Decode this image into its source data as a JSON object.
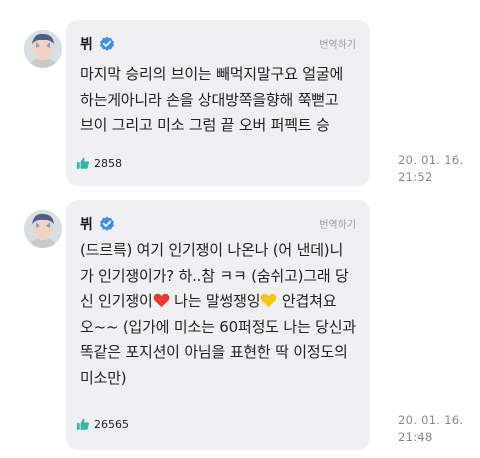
{
  "posts": [
    {
      "author": "뷔",
      "translate_label": "번역하기",
      "text": "마지막 승리의 브이는 빼먹지말구요 얼굴에\n하는게아니라 손을 상대방쪽을향해 쭉뻗고\n브이 그리고 미소 그럼 끝 오버 퍼펙트 승",
      "likes": "2858",
      "date": "20. 01. 16.",
      "time": "21:52"
    },
    {
      "author": "뷔",
      "translate_label": "번역하기",
      "text_before_heart": "(드르륵) 여기 인기쟁이 나온나 (어 낸데)니\n가 인기쟁이가? 하..참 ㅋㅋ (숨쉬고)그래 당\n신 인기쟁이",
      "red_heart": "❤️",
      "text_between_hearts": " 나는 말썽쟁잉",
      "yellow_heart": "💛",
      "text_after_heart": " 안겹쳐요\n오~~ (입가에 미소는 60퍼정도 나는 당신과\n똑같은 포지션이 아님을 표현한 딱 이정도의\n미소만)",
      "likes": "26565",
      "date": "20. 01. 16.",
      "time": "21:48"
    }
  ],
  "icons": {
    "verified": "verified-badge-icon",
    "like": "thumbs-up-icon"
  },
  "colors": {
    "verified_badge": "#3b8ff0",
    "like_icon": "#2fb8a3",
    "card_background": "#f0f0f3",
    "heart_red": "#e53935",
    "heart_yellow": "#f5c518"
  }
}
